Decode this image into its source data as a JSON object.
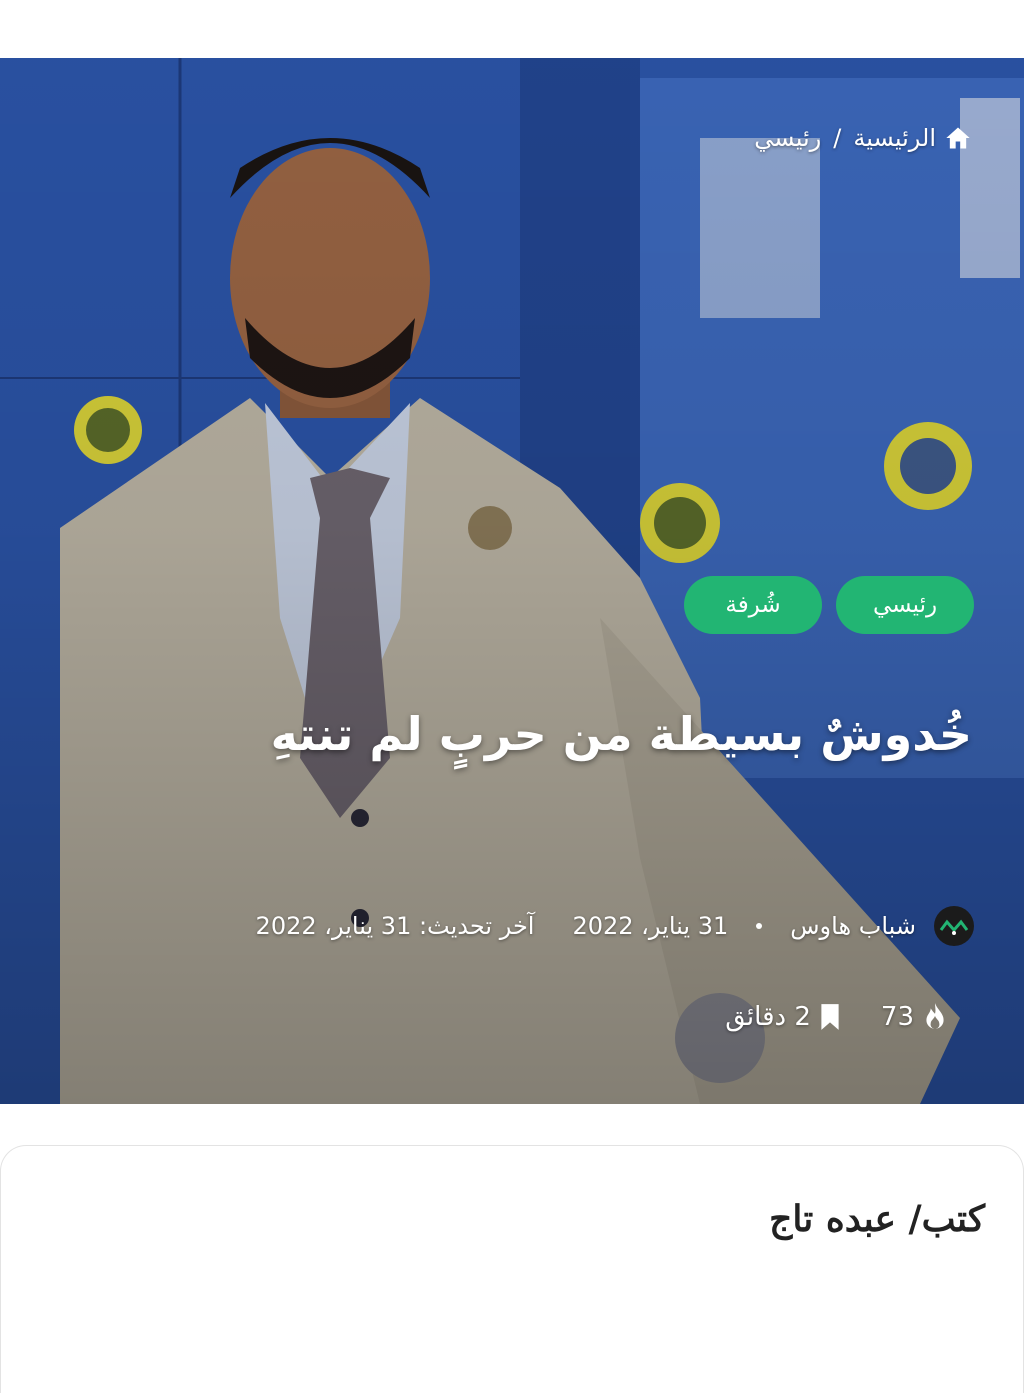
{
  "breadcrumb": {
    "home": "الرئيسية",
    "separator": "/",
    "current": "رئيسي"
  },
  "tags": [
    {
      "label": "رئيسي"
    },
    {
      "label": "شُرفة"
    }
  ],
  "article": {
    "title": "خُدوشٌ بسيطة من حربٍ لم تنتهِ",
    "author": "شباب هاوس",
    "published": "31 يناير، 2022",
    "updated": "آخر تحديث: 31 يناير، 2022",
    "views": "73",
    "read_time": "2 دقائق",
    "body_first_line": "كتب/ عبده تاج"
  },
  "colors": {
    "tag_bg": "#22b573",
    "hero_blue": "#2f5db5"
  },
  "icons": {
    "home": "home-icon",
    "author_logo": "author-logo-icon",
    "views": "flame-icon",
    "read_time": "bookmark-icon"
  }
}
